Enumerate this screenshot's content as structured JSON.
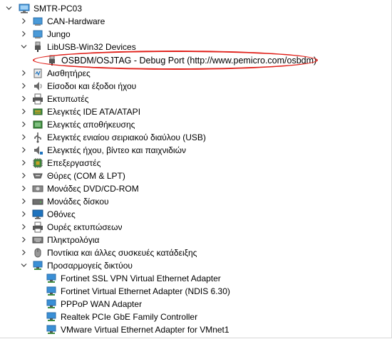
{
  "tree": {
    "root": {
      "label": "SMTR-PC03",
      "icon": "computer-icon",
      "expanded": true
    },
    "items": [
      {
        "id": "can-hardware",
        "label": "CAN-Hardware",
        "icon": "device-icon",
        "expanded": false
      },
      {
        "id": "jungo",
        "label": "Jungo",
        "icon": "device-icon",
        "expanded": false
      },
      {
        "id": "libusb",
        "label": "LibUSB-Win32 Devices",
        "icon": "usb-plug-icon",
        "expanded": true,
        "children": [
          {
            "id": "osbdm",
            "label": "OSBDM/OSJTAG - Debug Port (http://www.pemicro.com/osbdm)",
            "icon": "usb-plug-icon",
            "highlighted": true
          }
        ]
      },
      {
        "id": "sensors",
        "label": "Αισθητήρες",
        "icon": "sensor-icon",
        "expanded": false
      },
      {
        "id": "audio-io",
        "label": "Είσοδοι και έξοδοι ήχου",
        "icon": "speaker-icon",
        "expanded": false
      },
      {
        "id": "printers",
        "label": "Εκτυπωτές",
        "icon": "printer-icon",
        "expanded": false
      },
      {
        "id": "ide",
        "label": "Ελεγκτές IDE ATA/ATAPI",
        "icon": "ide-controller-icon",
        "expanded": false
      },
      {
        "id": "storage-controllers",
        "label": "Ελεγκτές αποθήκευσης",
        "icon": "storage-controller-icon",
        "expanded": false
      },
      {
        "id": "usb-controllers",
        "label": "Ελεγκτές ενιαίου σειριακού διαύλου (USB)",
        "icon": "usb-controller-icon",
        "expanded": false
      },
      {
        "id": "sound-video",
        "label": "Ελεγκτές ήχου, βίντεο και παιχνιδιών",
        "icon": "sound-card-icon",
        "expanded": false
      },
      {
        "id": "processors",
        "label": "Επεξεργαστές",
        "icon": "processor-icon",
        "expanded": false
      },
      {
        "id": "ports",
        "label": "Θύρες (COM & LPT)",
        "icon": "port-icon",
        "expanded": false
      },
      {
        "id": "dvd",
        "label": "Μονάδες DVD/CD-ROM",
        "icon": "dvd-icon",
        "expanded": false
      },
      {
        "id": "disks",
        "label": "Μονάδες δίσκου",
        "icon": "disk-icon",
        "expanded": false
      },
      {
        "id": "monitors",
        "label": "Οθόνες",
        "icon": "monitor-icon",
        "expanded": false
      },
      {
        "id": "print-queues",
        "label": "Ουρές εκτυπώσεων",
        "icon": "print-queue-icon",
        "expanded": false
      },
      {
        "id": "keyboards",
        "label": "Πληκτρολόγια",
        "icon": "keyboard-icon",
        "expanded": false
      },
      {
        "id": "mice",
        "label": "Ποντίκια και άλλες συσκευές κατάδειξης",
        "icon": "mouse-icon",
        "expanded": false
      },
      {
        "id": "network",
        "label": "Προσαρμογείς δικτύου",
        "icon": "network-adapter-icon",
        "expanded": true,
        "children": [
          {
            "id": "fortinet-ssl",
            "label": "Fortinet SSL VPN Virtual Ethernet Adapter",
            "icon": "network-adapter-icon"
          },
          {
            "id": "fortinet-ndis",
            "label": "Fortinet Virtual Ethernet Adapter (NDIS 6.30)",
            "icon": "network-adapter-icon"
          },
          {
            "id": "pppoe",
            "label": "PPPoP WAN Adapter",
            "icon": "network-adapter-icon"
          },
          {
            "id": "realtek",
            "label": "Realtek PCIe GbE Family Controller",
            "icon": "network-adapter-icon"
          },
          {
            "id": "vmware",
            "label": "VMware Virtual Ethernet Adapter for VMnet1",
            "icon": "network-adapter-icon"
          }
        ]
      }
    ]
  },
  "colors": {
    "highlight_ring": "#e0201a",
    "chevron": "#3c3c3c",
    "icon_blue": "#1e73be",
    "icon_gray": "#6b6b6b"
  }
}
